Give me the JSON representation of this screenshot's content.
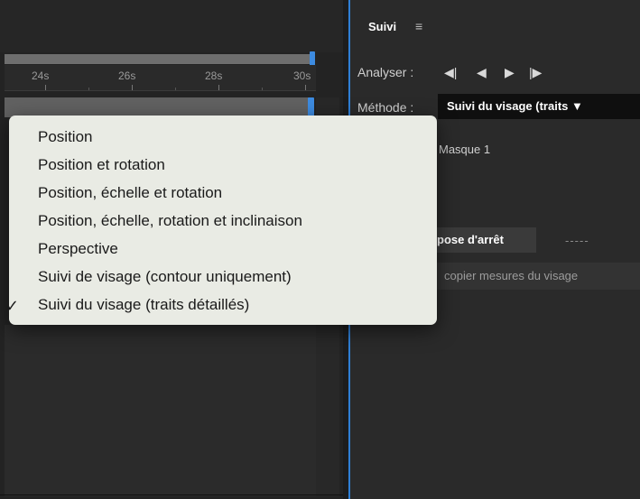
{
  "timeline": {
    "ticks": [
      "24s",
      "26s",
      "28s",
      "30s"
    ]
  },
  "panel": {
    "title": "Suivi",
    "menu_icon": "≡",
    "analyze_label": "Analyser :",
    "analyze_controls": {
      "step_back": "◀|",
      "play_back": "◀",
      "play_forward": "▶",
      "step_forward": "|▶"
    },
    "method_label": "Méthode :",
    "method_value": "Suivi du visage (traits ▼",
    "mask_label": "Masque 1",
    "pose_button": "pose d'arrêt",
    "pose_value": "-----",
    "copy_button": "copier mesures du visage"
  },
  "menu": {
    "items": [
      "Position",
      "Position et rotation",
      "Position, échelle et rotation",
      "Position, échelle, rotation et inclinaison",
      "Perspective",
      "Suivi de visage (contour uniquement)",
      "Suivi du visage (traits détaillés)"
    ],
    "checkmark": "✓",
    "selected_index": 6
  },
  "colors": {
    "accent": "#2f7fd6",
    "menu_bg": "#e9ebe4",
    "panel_bg": "#2a2a2a"
  }
}
